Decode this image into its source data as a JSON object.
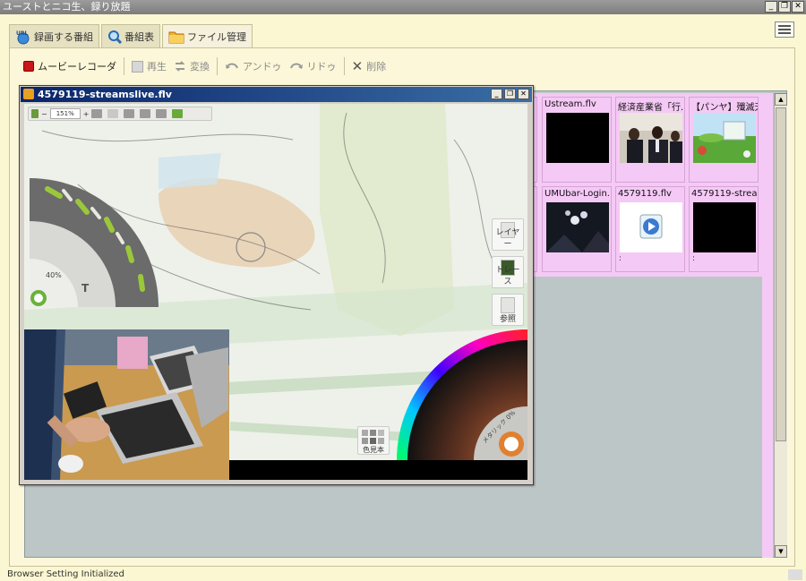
{
  "app": {
    "title": "ユーストとニコ生、録り放題"
  },
  "window_buttons": {
    "minimize": "_",
    "restore": "❐",
    "close": "✕"
  },
  "tabs": [
    {
      "label": "録画する番組",
      "icon": "url-globe-icon"
    },
    {
      "label": "番組表",
      "icon": "magnifier-icon"
    },
    {
      "label": "ファイル管理",
      "icon": "folder-icon"
    }
  ],
  "toolbar": {
    "movie_recorder": "ムービーレコーダ",
    "play": "再生",
    "convert": "変換",
    "undo": "アンドゥ",
    "redo": "リドゥ",
    "delete": "削除"
  },
  "files": [
    {
      "name": "Ustream.flv",
      "thumb": "black"
    },
    {
      "name": "経済産業省「行...",
      "thumb": "press-conference"
    },
    {
      "name": "【パンヤ】殲滅天...",
      "thumb": "golf-game"
    },
    {
      "name": "UMUbar-Login....",
      "thumb": "concert"
    },
    {
      "name": "4579119.flv",
      "thumb": "media-icon",
      "sub": ":"
    },
    {
      "name": "4579119-strea....",
      "thumb": "black",
      "sub": ":"
    }
  ],
  "player": {
    "title": "4579119-streamslive.flv",
    "zoom": "151%",
    "brush_percent": "40%",
    "text_tool": "T",
    "layer_label": "レイヤー",
    "trace_label": "トレース",
    "reference_label": "参照",
    "swatch_label": "色見本",
    "metallic_label": "メタリック 0%"
  },
  "status": {
    "text": "Browser Setting Initialized"
  },
  "scrollbar": {
    "up": "▲",
    "down": "▼"
  }
}
